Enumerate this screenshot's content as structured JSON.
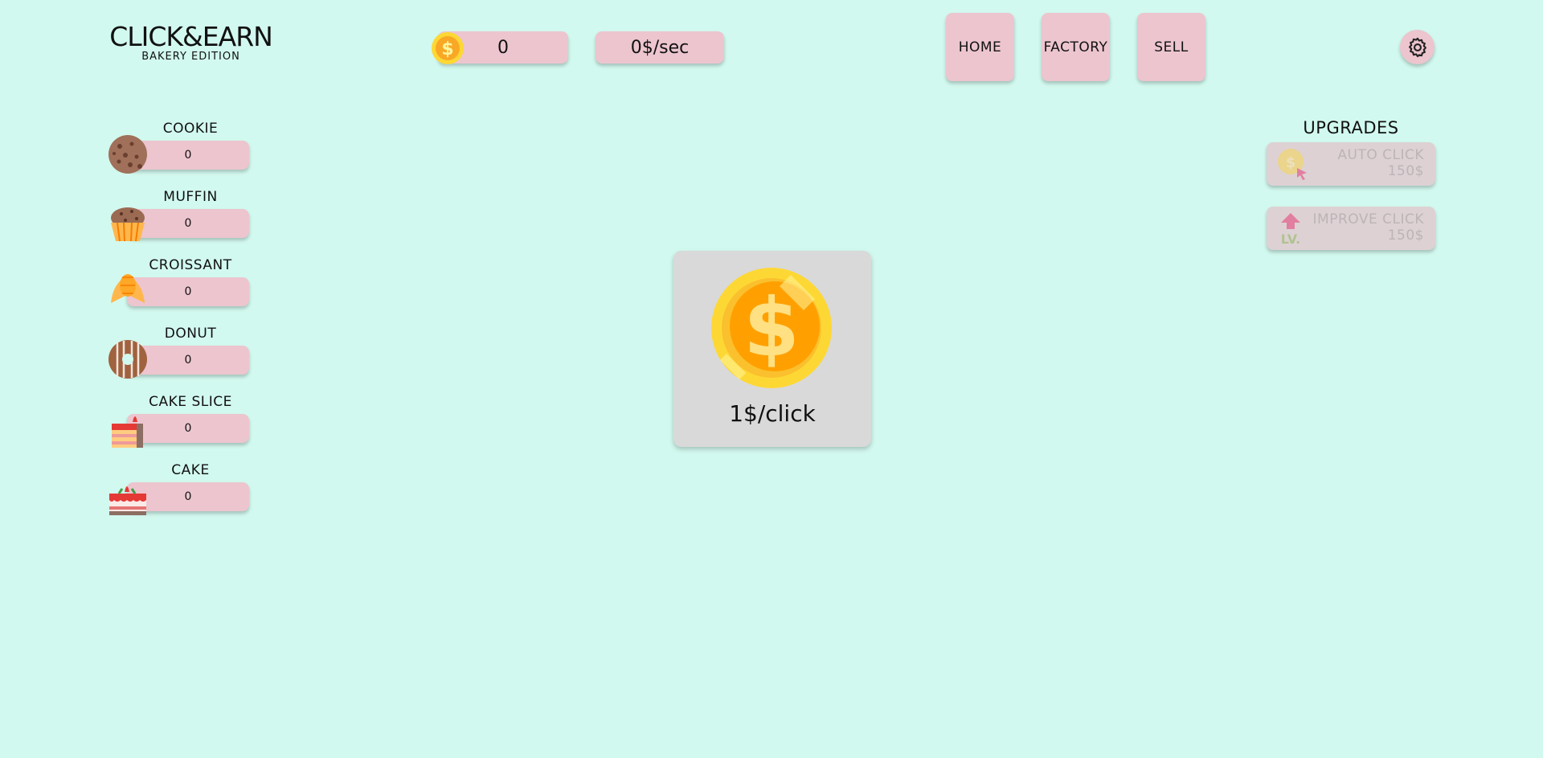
{
  "logo": {
    "title": "CLICK&EARN",
    "subtitle": "BAKERY EDITION"
  },
  "stats": {
    "money": "0",
    "rate": "0$/sec"
  },
  "nav": {
    "home": "HOME",
    "factory": "FACTORY",
    "sell": "SELL"
  },
  "settings_icon": "gear-icon",
  "items": [
    {
      "label": "COOKIE",
      "count": "0",
      "icon": "cookie-icon"
    },
    {
      "label": "MUFFIN",
      "count": "0",
      "icon": "muffin-icon"
    },
    {
      "label": "CROISSANT",
      "count": "0",
      "icon": "croissant-icon"
    },
    {
      "label": "DONUT",
      "count": "0",
      "icon": "donut-icon"
    },
    {
      "label": "CAKE SLICE",
      "count": "0",
      "icon": "cake-slice-icon"
    },
    {
      "label": "CAKE",
      "count": "0",
      "icon": "cake-icon"
    }
  ],
  "upgrades": {
    "title": "UPGRADES",
    "items": [
      {
        "name": "AUTO CLICK",
        "price": "150$",
        "icon": "auto-click-icon"
      },
      {
        "name": "IMPROVE CLICK",
        "price": "150$",
        "icon": "level-up-icon"
      }
    ]
  },
  "clicker": {
    "label": "1$/click",
    "icon": "coin-icon"
  },
  "colors": {
    "background": "#d2f9ef",
    "pill": "#ecc5cf",
    "panel": "#d9d9d9",
    "coin": "#fbc02d"
  }
}
